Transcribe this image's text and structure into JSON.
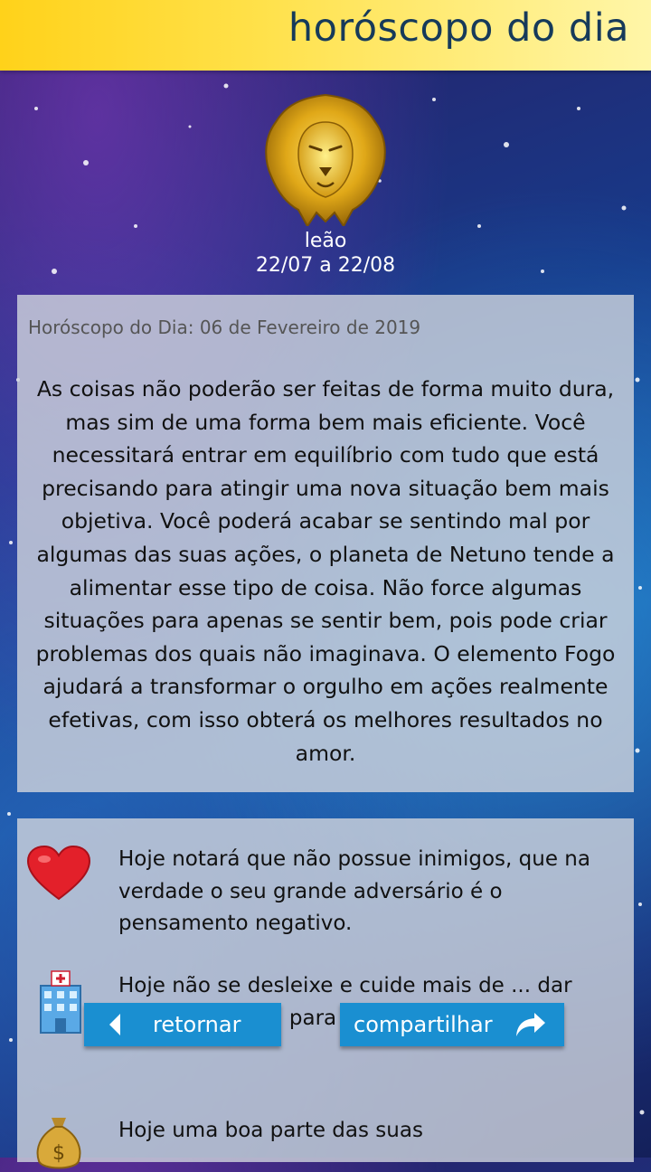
{
  "header": {
    "title": "horóscopo do dia"
  },
  "sign": {
    "icon": "lion-head-icon",
    "name": "leão",
    "dates": "22/07 a 22/08"
  },
  "reading": {
    "date_line": "Horóscopo do Dia: 06 de Fevereiro de 2019",
    "text": "As coisas não poderão ser feitas de forma muito dura, mas sim de uma forma bem mais eficiente. Você necessitará entrar em equilíbrio com tudo que está precisando para atingir uma nova situação bem mais objetiva. Você poderá acabar se sentindo mal por algumas das suas ações, o planeta de Netuno tende a alimentar esse tipo de coisa. Não force algumas situações para apenas se sentir bem, pois pode criar problemas dos quais não imaginava. O elemento Fogo ajudará a transformar o orgulho em ações realmente efetivas, com isso obterá os melhores resultados no amor."
  },
  "predictions": [
    {
      "icon": "heart-icon",
      "text": "Hoje notará que não possue inimigos, que na verdade o seu grande adversário é o pensamento negativo."
    },
    {
      "icon": "hospital-icon",
      "text": "Hoje não se desleixe e cuide mais de ... dar u... importância para a sua saúde."
    },
    {
      "icon": "money-bag-icon",
      "text": "Hoje uma boa parte das suas"
    }
  ],
  "buttons": {
    "back_label": "retornar",
    "share_label": "compartilhar"
  },
  "colors": {
    "header_yellow": "#ffd21a",
    "header_text": "#163a5a",
    "button_blue": "#1a8fd1",
    "heart_red": "#e3202a"
  }
}
